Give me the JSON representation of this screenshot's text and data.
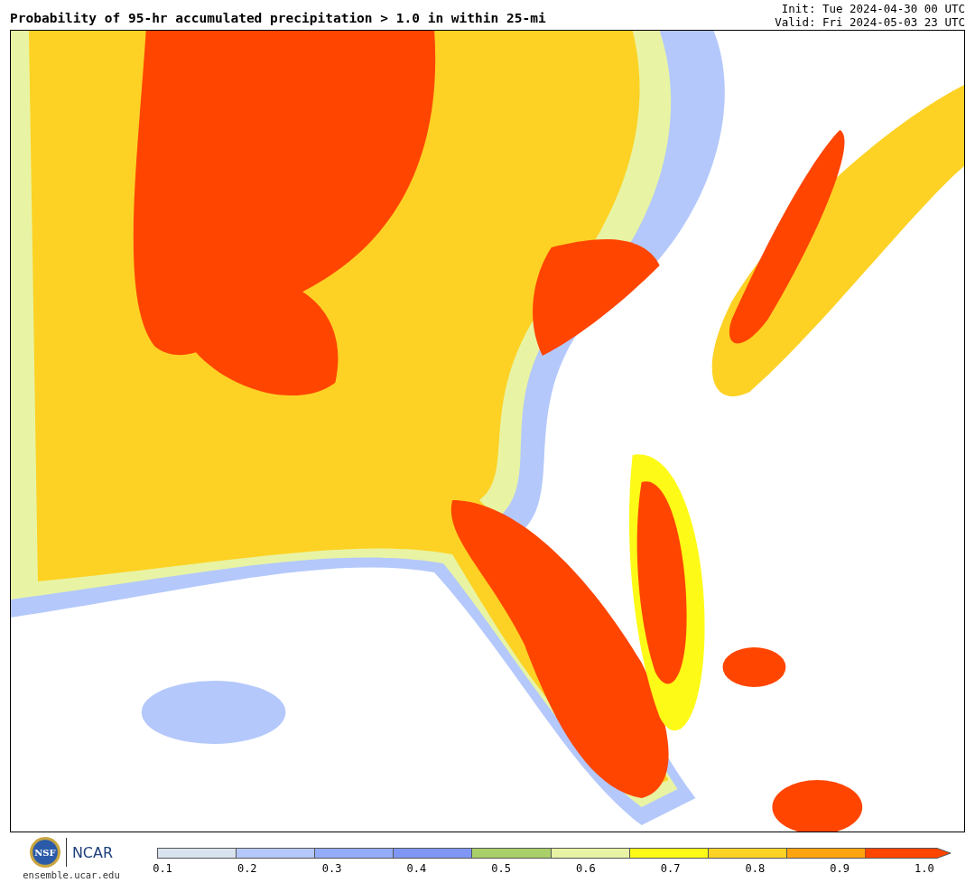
{
  "title": "Probability of 95-hr accumulated precipitation > 1.0 in within 25-mi",
  "init": "Init: Tue 2024-04-30 00 UTC",
  "valid": "Valid: Fri 2024-05-03 23 UTC",
  "logo": {
    "nsf": "NSF",
    "ncar": "NCAR",
    "site": "ensemble.ucar.edu"
  },
  "colorbar": {
    "bins": [
      {
        "color": "#d9e3ee"
      },
      {
        "color": "#b4c8fb"
      },
      {
        "color": "#94acfa"
      },
      {
        "color": "#7f96f5"
      },
      {
        "color": "#a8cf68"
      },
      {
        "color": "#e8f4a4"
      },
      {
        "color": "#fdfa18"
      },
      {
        "color": "#fdd225"
      },
      {
        "color": "#fea40e"
      },
      {
        "color": "#ff4500",
        "kind": "arrow"
      }
    ],
    "ticks": [
      "0.1",
      "0.2",
      "0.3",
      "0.4",
      "0.5",
      "0.6",
      "0.7",
      "0.8",
      "0.9",
      "1.0"
    ]
  }
}
